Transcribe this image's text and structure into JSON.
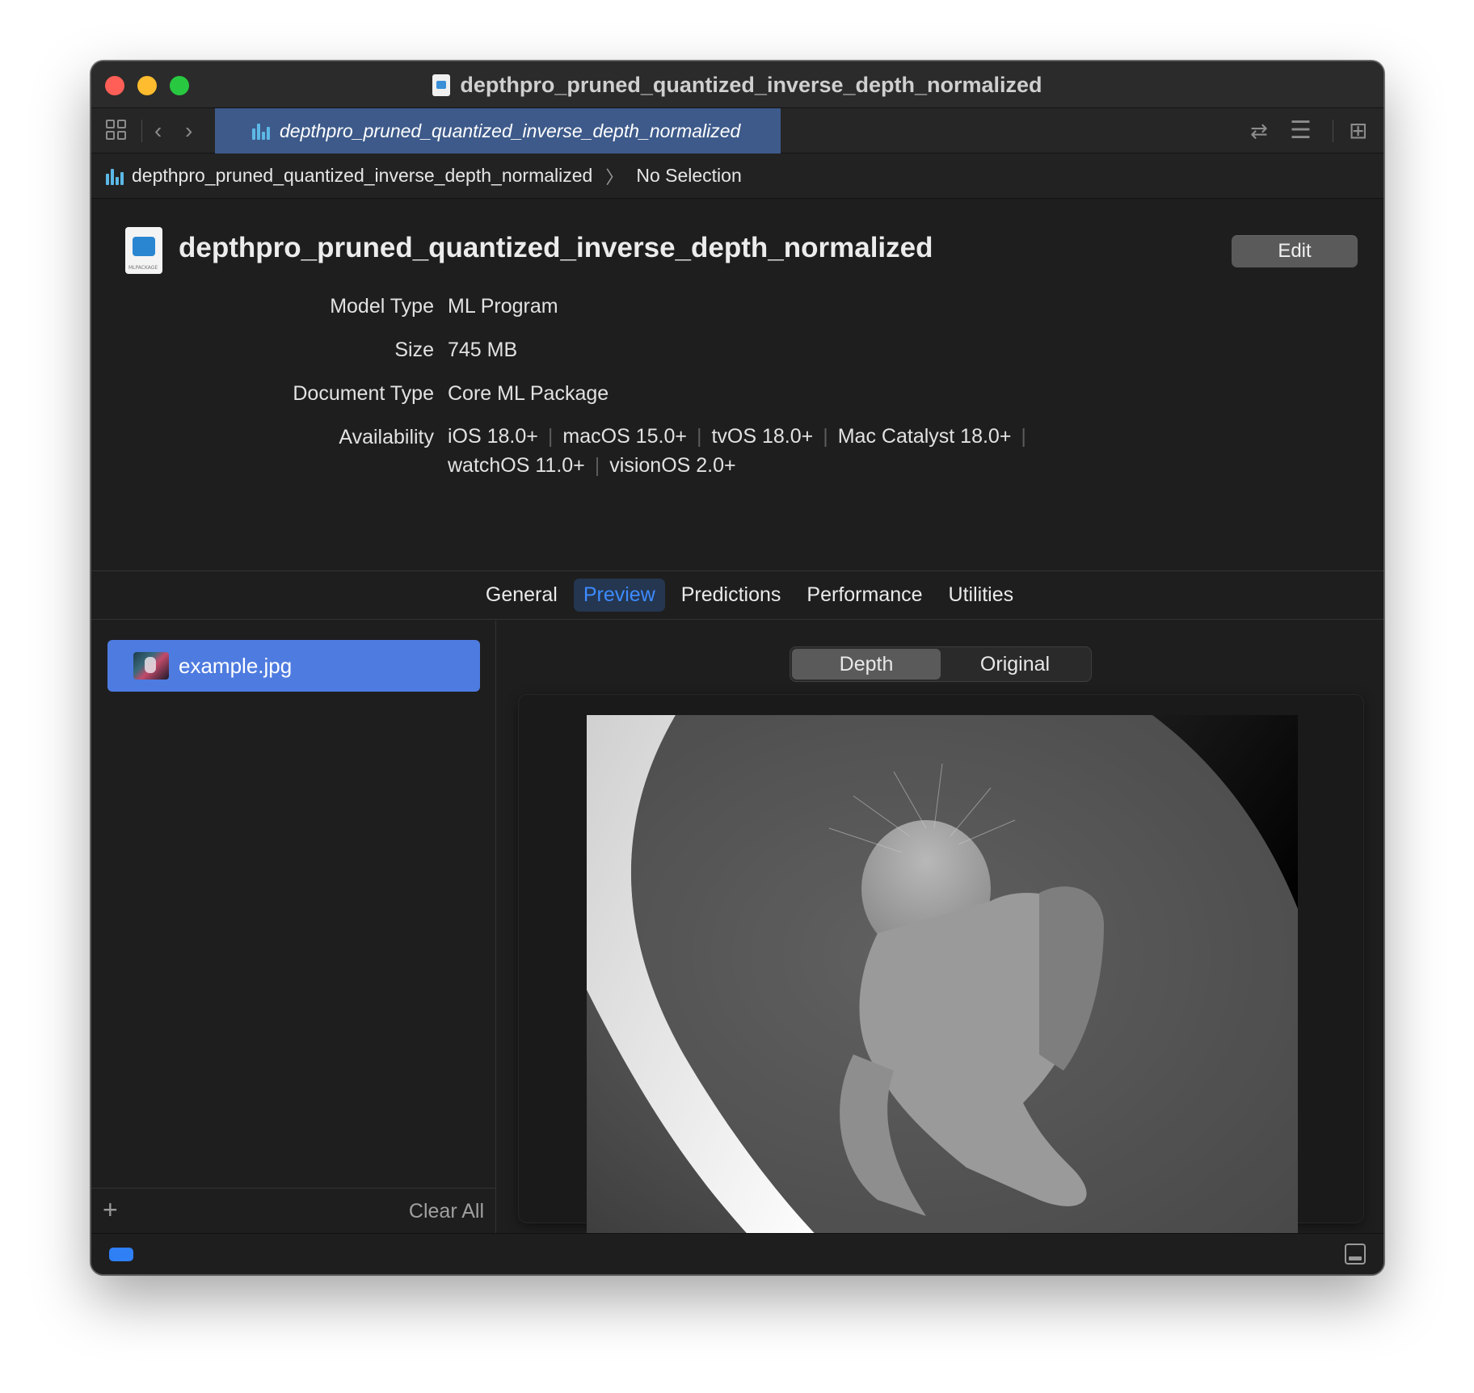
{
  "window": {
    "title": "depthpro_pruned_quantized_inverse_depth_normalized"
  },
  "tabbar": {
    "active_tab_label": "depthpro_pruned_quantized_inverse_depth_normalized"
  },
  "breadcrumb": {
    "file": "depthpro_pruned_quantized_inverse_depth_normalized",
    "selection": "No Selection"
  },
  "header": {
    "model_name": "depthpro_pruned_quantized_inverse_depth_normalized",
    "edit_label": "Edit"
  },
  "properties": {
    "model_type_label": "Model Type",
    "model_type_value": "ML Program",
    "size_label": "Size",
    "size_value": "745 MB",
    "document_type_label": "Document Type",
    "document_type_value": "Core ML Package",
    "availability_label": "Availability",
    "availability": [
      "iOS 18.0+",
      "macOS 15.0+",
      "tvOS 18.0+",
      "Mac Catalyst 18.0+",
      "watchOS 11.0+",
      "visionOS 2.0+"
    ]
  },
  "tabs": [
    {
      "label": "General",
      "active": false
    },
    {
      "label": "Preview",
      "active": true
    },
    {
      "label": "Predictions",
      "active": false
    },
    {
      "label": "Performance",
      "active": false
    },
    {
      "label": "Utilities",
      "active": false
    }
  ],
  "sidebar": {
    "files": [
      {
        "name": "example.jpg",
        "selected": true
      }
    ],
    "add_label": "+",
    "clear_label": "Clear All"
  },
  "preview": {
    "segments": [
      {
        "label": "Depth",
        "active": true
      },
      {
        "label": "Original",
        "active": false
      }
    ]
  },
  "colors": {
    "accent": "#3d8bff",
    "selection": "#4e7be0",
    "tab_active": "#3d5a8a"
  }
}
